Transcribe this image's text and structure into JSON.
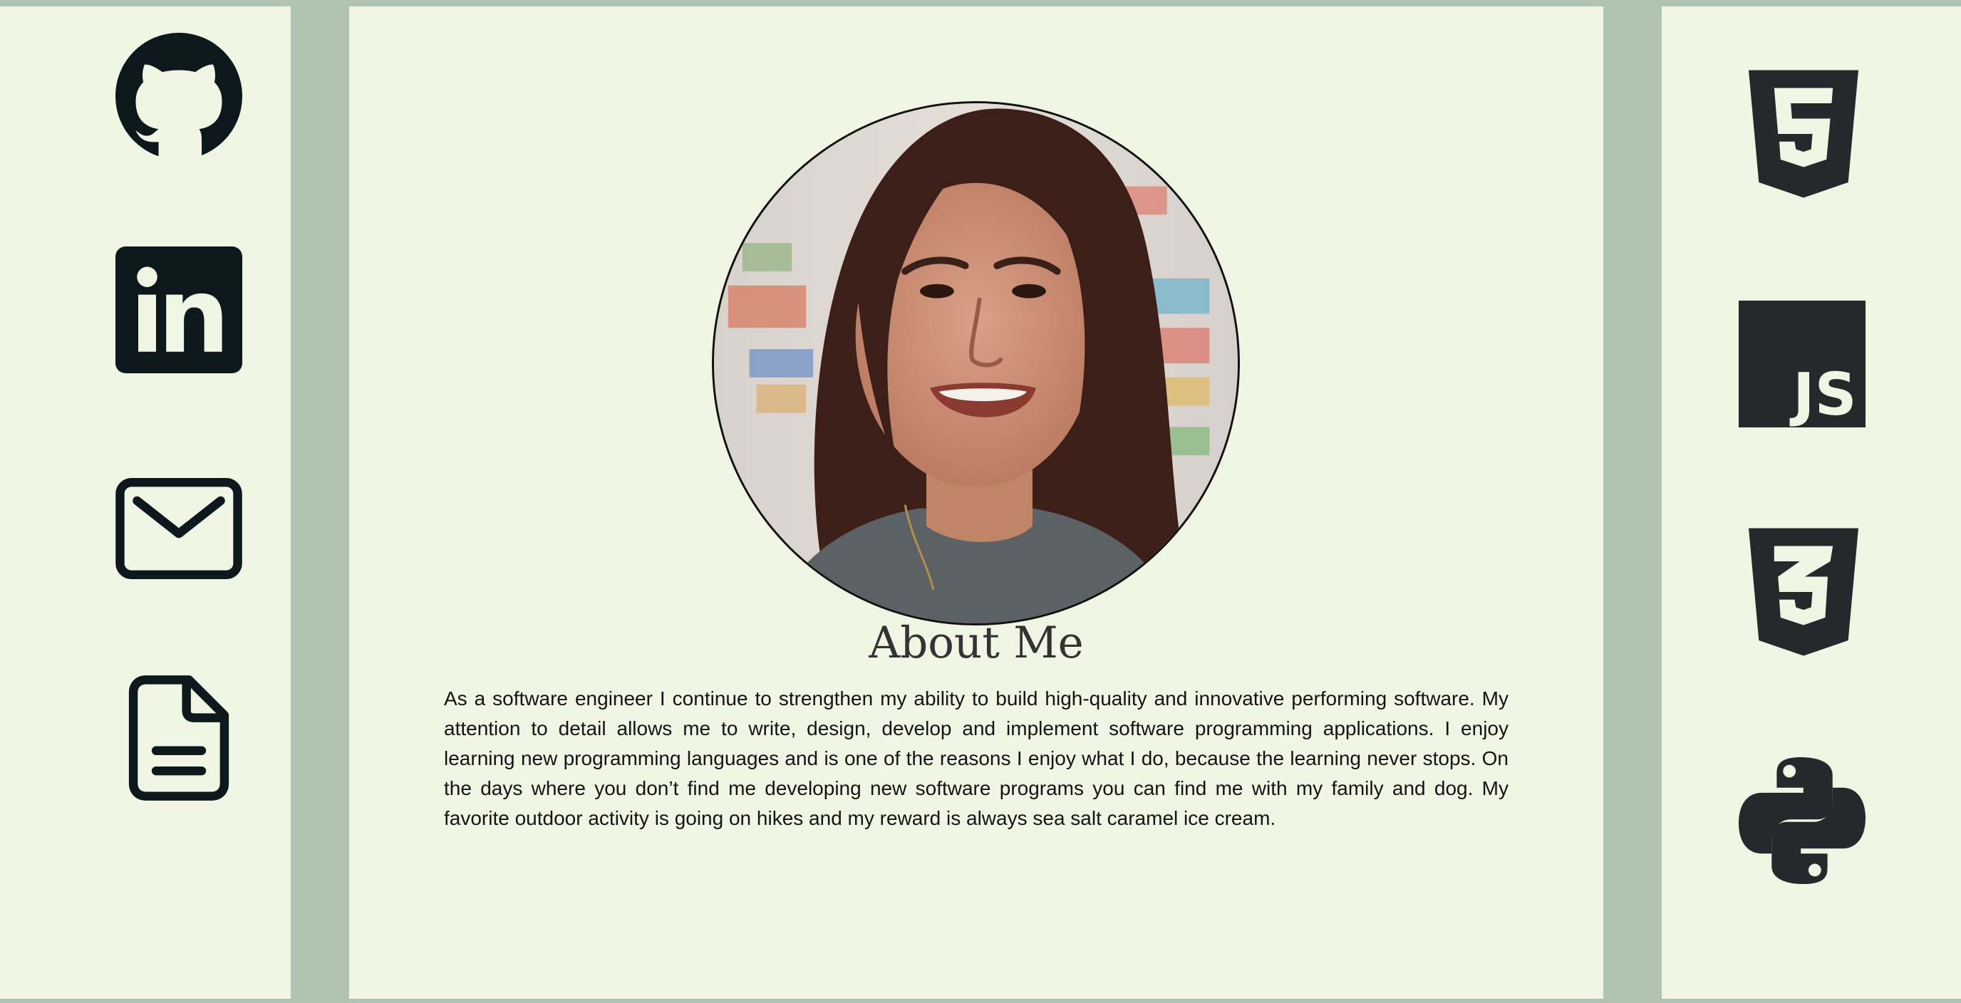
{
  "sidebar_left": {
    "links": [
      {
        "icon": "github-icon"
      },
      {
        "icon": "linkedin-icon"
      },
      {
        "icon": "mail-icon"
      },
      {
        "icon": "document-icon"
      }
    ]
  },
  "sidebar_right": {
    "tech_icons": [
      "html5-icon",
      "javascript-icon",
      "css3-icon",
      "python-icon"
    ],
    "js_label": "JS"
  },
  "about": {
    "title": "About Me",
    "body": "As a software engineer I continue to strengthen my ability to build high-quality and innovative performing software. My attention to detail allows me to write, design, develop and implement software programming applications. I enjoy learning new programming languages and is one of the reasons I enjoy what I do, because the learning never stops. On the days where you don’t find me developing new software programs you can find me with my family and dog. My favorite outdoor activity is going on hikes and my reward is always sea salt caramel ice cream."
  },
  "colors": {
    "background": "#b0c4b1",
    "panel": "#f1f6e4",
    "icon_dark": "#0d181c",
    "tech_icon": "#26292b"
  }
}
